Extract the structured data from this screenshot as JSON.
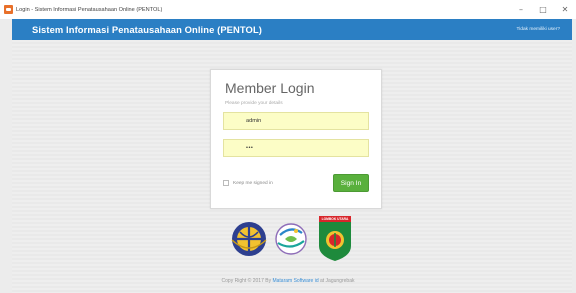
{
  "window": {
    "title": "Login - Sistem Informasi Penatausahaan Online (PENTOL)",
    "controls": {
      "minimize": "–",
      "maximize": "□",
      "close": "✕"
    }
  },
  "header": {
    "brand": "Sistem Informasi Penatausahaan Online (PENTOL)",
    "not_member_link": "Tidak memiliki user?"
  },
  "login": {
    "heading": "Member Login",
    "subheading": "Please provide your details",
    "username_value": "admin",
    "password_value": "•••",
    "remember_label": "Keep me signed in",
    "signin_label": "Sign In"
  },
  "logos": {
    "third_banner": "LOMBOK UTARA"
  },
  "footer": {
    "prefix": "Copy Right © 2017 By ",
    "company": "Mataram Software id",
    "suffix": " at Jagungrebak"
  },
  "colors": {
    "header_blue": "#2b7fc4",
    "signin_green": "#59b03c",
    "field_yellow": "#fcfdc6"
  }
}
